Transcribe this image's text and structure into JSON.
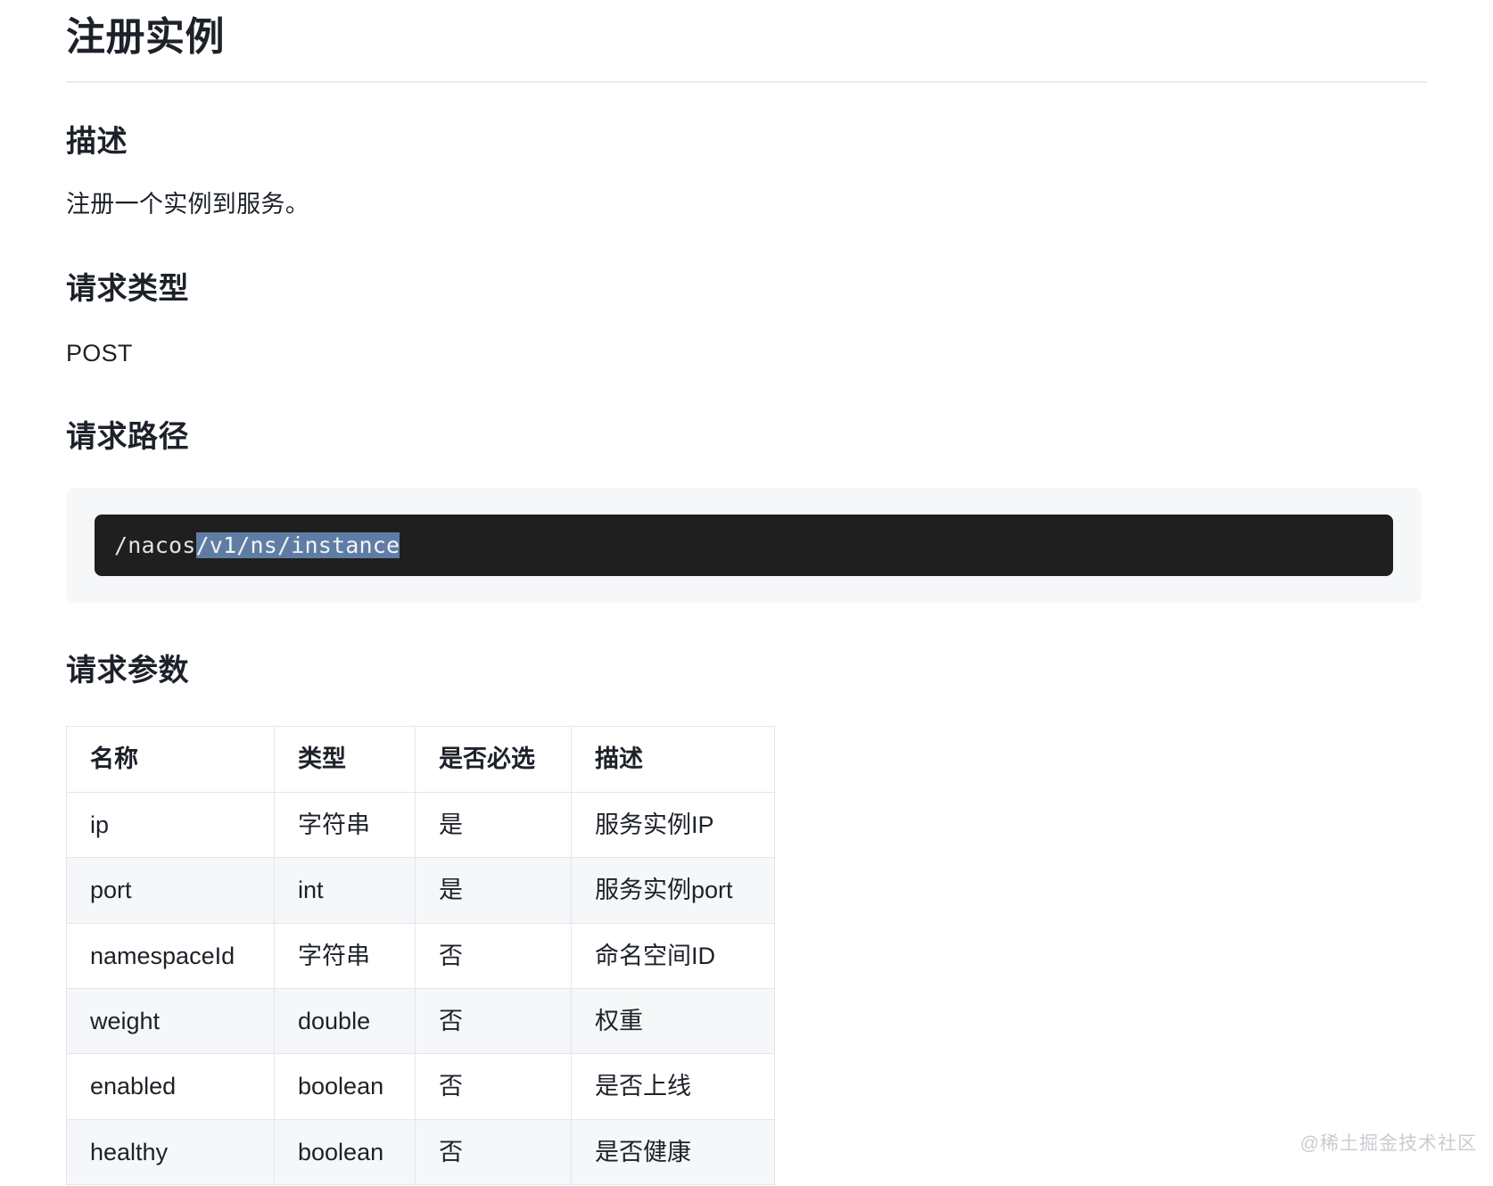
{
  "document": {
    "title": "注册实例",
    "watermark": "@稀土掘金技术社区"
  },
  "sections": {
    "description": {
      "heading": "描述",
      "text": "注册一个实例到服务。"
    },
    "method": {
      "heading": "请求类型",
      "value": "POST"
    },
    "path": {
      "heading": "请求路径",
      "code_prefix": "/nacos",
      "code_selected": "/v1/ns/instance",
      "selection_color": "#5f7da4",
      "code_background": "#1f1f1f",
      "wrapper_background": "#f6f7f9"
    },
    "params": {
      "heading": "请求参数",
      "columns": [
        "名称",
        "类型",
        "是否必选",
        "描述"
      ],
      "rows": [
        {
          "name": "ip",
          "type": "字符串",
          "required": "是",
          "desc": "服务实例IP"
        },
        {
          "name": "port",
          "type": "int",
          "required": "是",
          "desc": "服务实例port"
        },
        {
          "name": "namespaceId",
          "type": "字符串",
          "required": "否",
          "desc": "命名空间ID"
        },
        {
          "name": "weight",
          "type": "double",
          "required": "否",
          "desc": "权重"
        },
        {
          "name": "enabled",
          "type": "boolean",
          "required": "否",
          "desc": "是否上线"
        },
        {
          "name": "healthy",
          "type": "boolean",
          "required": "否",
          "desc": "是否健康"
        }
      ]
    }
  }
}
